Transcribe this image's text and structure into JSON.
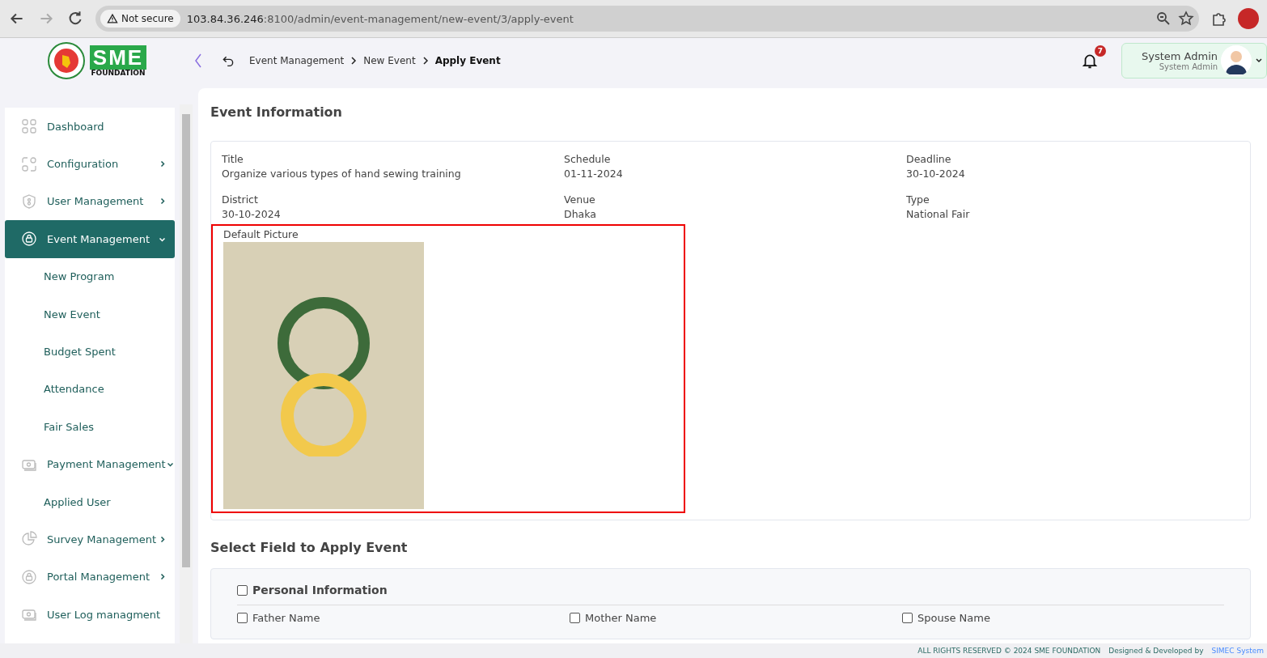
{
  "browser": {
    "security": "Not secure",
    "url_host": "103.84.36.246",
    "url_rest": ":8100/admin/event-management/new-event/3/apply-event"
  },
  "logo": {
    "text": "SME",
    "subtext": "FOUNDATION"
  },
  "breadcrumb": [
    {
      "label": "Event Management",
      "current": false
    },
    {
      "label": "New Event",
      "current": false
    },
    {
      "label": "Apply Event",
      "current": true
    }
  ],
  "notifications": {
    "count": "7"
  },
  "user": {
    "name": "System Admin",
    "role": "System Admin"
  },
  "sidebar": {
    "items": [
      {
        "label": "Dashboard",
        "kind": "link",
        "selected": false
      },
      {
        "label": "Configuration",
        "kind": "group",
        "expanded": false,
        "selected": false
      },
      {
        "label": "User Management",
        "kind": "group",
        "expanded": false,
        "selected": false
      },
      {
        "label": "Event Management",
        "kind": "group",
        "expanded": true,
        "selected": true
      },
      {
        "label": "New Program",
        "kind": "sub",
        "selected": false
      },
      {
        "label": "New Event",
        "kind": "sub",
        "selected": false
      },
      {
        "label": "Budget Spent",
        "kind": "sub",
        "selected": false
      },
      {
        "label": "Attendance",
        "kind": "sub",
        "selected": false
      },
      {
        "label": "Fair Sales",
        "kind": "sub",
        "selected": false
      },
      {
        "label": "Payment Management",
        "kind": "group",
        "expanded": true,
        "selected": false
      },
      {
        "label": "Applied User",
        "kind": "sub",
        "selected": false
      },
      {
        "label": "Survey Management",
        "kind": "group",
        "expanded": false,
        "selected": false
      },
      {
        "label": "Portal Management",
        "kind": "group",
        "expanded": false,
        "selected": false
      },
      {
        "label": "User Log managment",
        "kind": "link",
        "selected": false
      }
    ]
  },
  "event_info": {
    "heading": "Event Information",
    "fields": [
      {
        "label": "Title",
        "value": "Organize various types of hand sewing training"
      },
      {
        "label": "Schedule",
        "value": "01-11-2024"
      },
      {
        "label": "Deadline",
        "value": "30-10-2024"
      },
      {
        "label": "District",
        "value": "30-10-2024"
      },
      {
        "label": "Venue",
        "value": "Dhaka"
      },
      {
        "label": "Type",
        "value": "National Fair"
      }
    ],
    "picture_label": "Default Picture"
  },
  "apply_fields": {
    "heading": "Select Field to Apply Event",
    "group": {
      "label": "Personal Information",
      "checked": false
    },
    "fields": [
      {
        "label": "Father Name",
        "checked": false
      },
      {
        "label": "Mother Name",
        "checked": false
      },
      {
        "label": "Spouse Name",
        "checked": false
      }
    ]
  },
  "footer": {
    "text": "ALL RIGHTS RESERVED © 2024 SME FOUNDATION",
    "credit": "Designed & Developed by",
    "link": "SIMEC System"
  }
}
